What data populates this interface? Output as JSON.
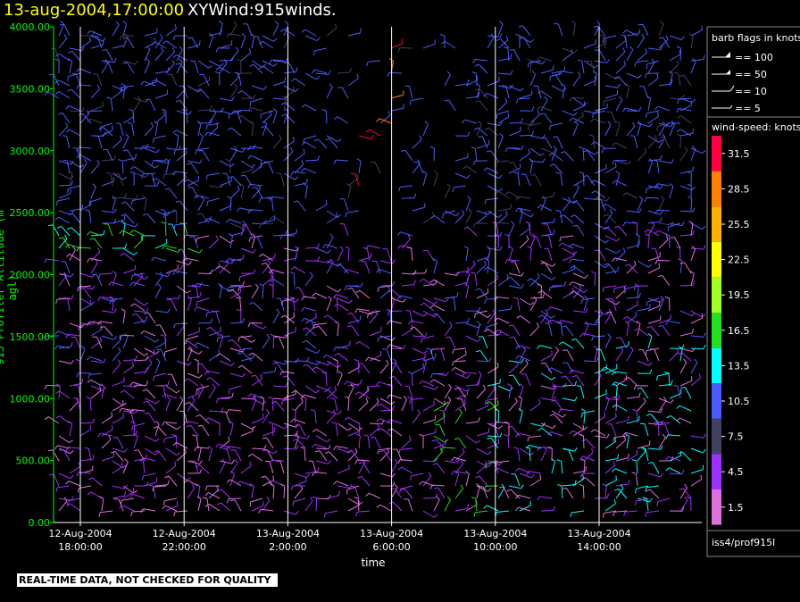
{
  "header": {
    "time_text": "13-aug-2004,17:00:00",
    "product_text": "XYWind:915winds."
  },
  "footer": {
    "warning": "REAL-TIME DATA, NOT CHECKED FOR QUALITY",
    "station": "iss4/prof915l"
  },
  "chart_data": {
    "type": "scatter",
    "subtype": "wind-barb time-height",
    "ylabel": "915 Profiler Altitude (m agl)",
    "xlabel": "time",
    "ylim": [
      0,
      4000
    ],
    "y_ticks": [
      "0.00",
      "500.00",
      "1000.00",
      "1500.00",
      "2000.00",
      "2500.00",
      "3000.00",
      "3500.00",
      "4000.00"
    ],
    "x_ticks": [
      {
        "date": "12-Aug-2004",
        "time": "18:00:00"
      },
      {
        "date": "12-Aug-2004",
        "time": "22:00:00"
      },
      {
        "date": "13-Aug-2004",
        "time": "2:00:00"
      },
      {
        "date": "13-Aug-2004",
        "time": "6:00:00"
      },
      {
        "date": "13-Aug-2004",
        "time": "10:00:00"
      },
      {
        "date": "13-Aug-2004",
        "time": "14:00:00"
      }
    ],
    "vertical_gridlines": true,
    "barb_legend": {
      "title": "barb flags in knots",
      "items": [
        "== 100",
        "== 50",
        "== 10",
        "== 5"
      ]
    },
    "color_scale": {
      "title": "wind-speed: knots",
      "levels": [
        {
          "label": "31.5",
          "color": "#ff0040"
        },
        {
          "label": "28.5",
          "color": "#ff8000"
        },
        {
          "label": "25.5",
          "color": "#ffb000"
        },
        {
          "label": "22.5",
          "color": "#ffff00"
        },
        {
          "label": "19.5",
          "color": "#a0ff20"
        },
        {
          "label": "16.5",
          "color": "#20e020"
        },
        {
          "label": "13.5",
          "color": "#00ffff"
        },
        {
          "label": "10.5",
          "color": "#4a5cff"
        },
        {
          "label": "7.5",
          "color": "#404060"
        },
        {
          "label": "4.5",
          "color": "#a030ff"
        },
        {
          "label": "1.5",
          "color": "#e070e0"
        }
      ]
    }
  }
}
